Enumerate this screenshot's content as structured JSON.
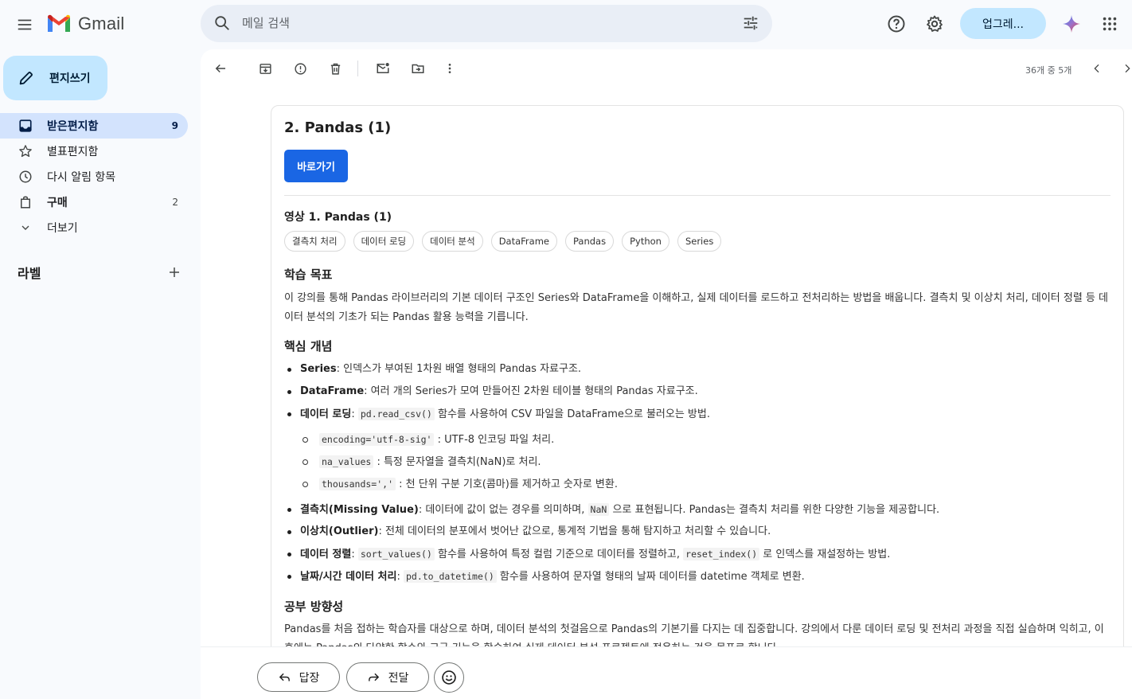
{
  "app": {
    "name": "Gmail"
  },
  "search": {
    "placeholder": "메일 검색"
  },
  "header": {
    "upgrade_label": "업그레..."
  },
  "sidebar": {
    "compose_label": "편지쓰기",
    "items": [
      {
        "label": "받은편지함",
        "count": "9"
      },
      {
        "label": "별표편지함",
        "count": ""
      },
      {
        "label": "다시 알림 항목",
        "count": ""
      },
      {
        "label": "구매",
        "count": "2"
      },
      {
        "label": "더보기",
        "count": ""
      }
    ],
    "labels_title": "라벨"
  },
  "toolbar": {
    "pager": "36개 중 5개"
  },
  "email": {
    "section_title": "2. Pandas (1)",
    "go_button": "바로가기",
    "video_title": "영상 1. Pandas (1)",
    "tags": [
      "결측치 처리",
      "데이터 로딩",
      "데이터 분석",
      "DataFrame",
      "Pandas",
      "Python",
      "Series"
    ],
    "goal_title": "학습 목표",
    "goal_text": "이 강의를 통해 Pandas 라이브러리의 기본 데이터 구조인 Series와 DataFrame을 이해하고, 실제 데이터를 로드하고 전처리하는 방법을 배웁니다. 결측치 및 이상치 처리, 데이터 정렬 등 데이터 분석의 기초가 되는 Pandas 활용 능력을 기릅니다.",
    "concepts_title": "핵심 개념",
    "concepts": {
      "series_term": "Series",
      "series_desc": ": 인덱스가 부여된 1차원 배열 형태의 Pandas 자료구조.",
      "df_term": "DataFrame",
      "df_desc": ": 여러 개의 Series가 모여 만들어진 2차원 테이블 형태의 Pandas 자료구조.",
      "load_term": "데이터 로딩",
      "load_sep": ": ",
      "load_code": "pd.read_csv()",
      "load_desc": " 함수를 사용하여 CSV 파일을 DataFrame으로 불러오는 방법.",
      "enc_code": "encoding='utf-8-sig'",
      "enc_desc": " : UTF-8 인코딩 파일 처리.",
      "na_code": "na_values",
      "na_desc": " : 특정 문자열을 결측치(NaN)로 처리.",
      "th_code": "thousands=','",
      "th_desc": " : 천 단위 구분 기호(콤마)를 제거하고 숫자로 변환.",
      "missing_term": "결측치(Missing Value)",
      "missing_desc1": ": 데이터에 값이 없는 경우를 의미하며, ",
      "missing_code": "NaN",
      "missing_desc2": " 으로 표현됩니다. Pandas는 결측치 처리를 위한 다양한 기능을 제공합니다.",
      "outlier_term": "이상치(Outlier)",
      "outlier_desc": ": 전체 데이터의 분포에서 벗어난 값으로, 통계적 기법을 통해 탐지하고 처리할 수 있습니다.",
      "sort_term": "데이터 정렬",
      "sort_sep": ": ",
      "sort_code": "sort_values()",
      "sort_desc1": " 함수를 사용하여 특정 컬럼 기준으로 데이터를 정렬하고, ",
      "reset_code": "reset_index()",
      "sort_desc2": " 로 인덱스를 재설정하는 방법.",
      "dt_term": "날짜/시간 데이터 처리",
      "dt_sep": ": ",
      "dt_code": "pd.to_datetime()",
      "dt_desc": " 함수를 사용하여 문자열 형태의 날짜 데이터를 datetime 객체로 변환."
    },
    "direction_title": "공부 방향성",
    "direction_text": "Pandas를 처음 접하는 학습자를 대상으로 하며, 데이터 분석의 첫걸음으로 Pandas의 기본기를 다지는 데 집중합니다. 강의에서 다룬 데이터 로딩 및 전처리 과정을 직접 실습하며 익히고, 이후에는 Pandas의 다양한 함수와 고급 기능을 학습하여 실제 데이터 분석 프로젝트에 적용하는 것을 목표로 합니다."
  },
  "actions": {
    "reply": "답장",
    "forward": "전달"
  },
  "colors": {
    "accent": "#1a66e4",
    "compose_bg": "#c2e7ff",
    "active_nav": "#d3e3fd"
  }
}
